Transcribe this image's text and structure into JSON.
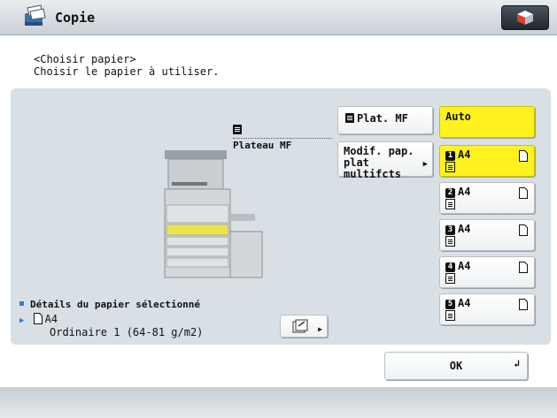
{
  "header": {
    "title": "Copie"
  },
  "instructions": {
    "line1": "<Choisir papier>",
    "line2": "Choisir le papier à utiliser."
  },
  "machine": {
    "tray_label": "Plateau MF"
  },
  "buttons": {
    "plat_mf": "Plat. MF",
    "modif_line1": "Modif. pap.",
    "modif_line2": "plat multifcts",
    "ok": "OK"
  },
  "trays": [
    {
      "label": "Auto"
    },
    {
      "num": "1",
      "size": "A4"
    },
    {
      "num": "2",
      "size": "A4"
    },
    {
      "num": "3",
      "size": "A4"
    },
    {
      "num": "4",
      "size": "A4"
    },
    {
      "num": "5",
      "size": "A4"
    }
  ],
  "details": {
    "title": "Détails du papier sélectionné",
    "size": "A4",
    "type": "Ordinaire 1 (64-81 g/m2)"
  },
  "colors": {
    "selected": "#fff21f",
    "panel": "#d9e0e5",
    "accent_blue": "#2b7fd3"
  }
}
